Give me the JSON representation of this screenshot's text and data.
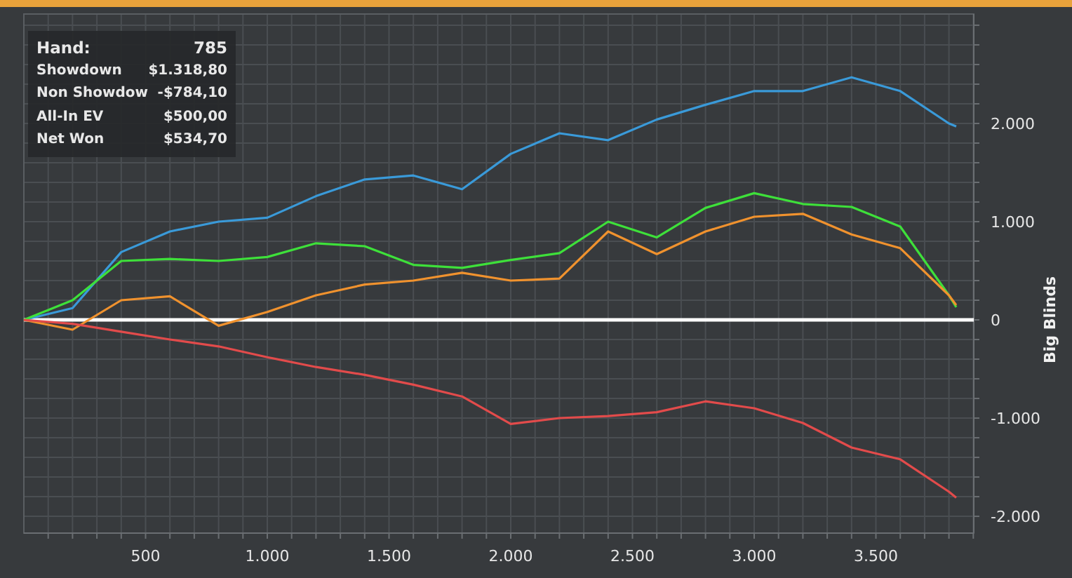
{
  "header_bar": {
    "color": "#e9a23b"
  },
  "chart": {
    "chart_data": {
      "type": "line",
      "grid": true,
      "ylabel": "Big Blinds",
      "x": [
        0,
        200,
        400,
        600,
        800,
        1000,
        1200,
        1400,
        1600,
        1800,
        2000,
        2200,
        2400,
        2600,
        2800,
        3000,
        3200,
        3400,
        3600,
        3800,
        3830
      ],
      "series": [
        {
          "color": "#3a9ad9",
          "values": [
            0,
            120,
            690,
            900,
            1000,
            1040,
            1260,
            1430,
            1470,
            1330,
            1690,
            1900,
            1830,
            2040,
            2190,
            2330,
            2330,
            2470,
            2330,
            2000,
            1970
          ]
        },
        {
          "color": "#3ee03a",
          "values": [
            0,
            200,
            600,
            620,
            600,
            640,
            780,
            750,
            560,
            530,
            610,
            680,
            1000,
            840,
            1140,
            1290,
            1180,
            1150,
            950,
            250,
            130
          ]
        },
        {
          "color": "#f0922e",
          "values": [
            0,
            -100,
            200,
            240,
            -60,
            80,
            250,
            360,
            400,
            480,
            400,
            420,
            900,
            670,
            900,
            1050,
            1080,
            870,
            730,
            250,
            150
          ]
        },
        {
          "color": "#e24b4b",
          "values": [
            0,
            -40,
            -120,
            -200,
            -270,
            -380,
            -480,
            -560,
            -660,
            -780,
            -1060,
            -1000,
            -980,
            -940,
            -830,
            -900,
            -1050,
            -1300,
            -1420,
            -1750,
            -1810
          ]
        }
      ],
      "xlim": [
        0,
        3902
      ],
      "ylim": [
        -2171,
        3114
      ],
      "xticks": [
        {
          "value": 500,
          "label": "500"
        },
        {
          "value": 1000,
          "label": "1.000"
        },
        {
          "value": 1500,
          "label": "1.500"
        },
        {
          "value": 2000,
          "label": "2.000"
        },
        {
          "value": 2500,
          "label": "2.500"
        },
        {
          "value": 3000,
          "label": "3.000"
        },
        {
          "value": 3500,
          "label": "3.500"
        }
      ],
      "yticks": [
        {
          "value": -2000,
          "label": "-2.000"
        },
        {
          "value": -1000,
          "label": "-1.000"
        },
        {
          "value": 0,
          "label": "0"
        },
        {
          "value": 1000,
          "label": "1.000"
        },
        {
          "value": 2000,
          "label": "2.000"
        }
      ]
    }
  },
  "tooltip": {
    "rows": [
      {
        "label": "Hand:",
        "value": "785"
      },
      {
        "label": "Showdown",
        "value": "$1.318,80"
      },
      {
        "label": "Non Showdow",
        "value": "-$784,10"
      },
      {
        "label": "All-In EV",
        "value": "$500,00"
      },
      {
        "label": "Net Won",
        "value": "$534,70"
      }
    ]
  }
}
